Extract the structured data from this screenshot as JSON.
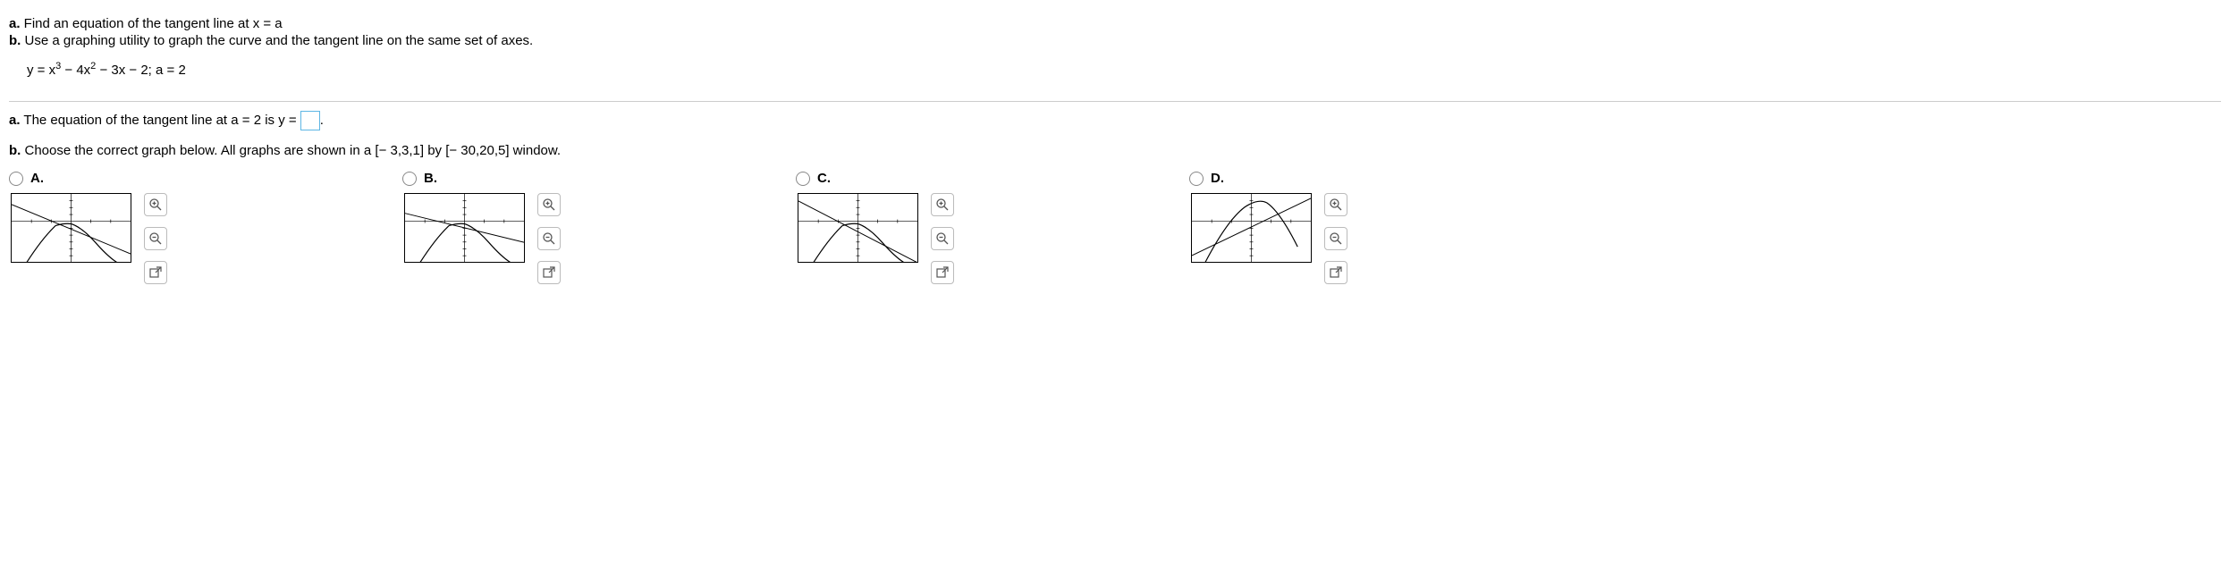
{
  "part_a_label": "a.",
  "part_a_text": " Find an equation of the tangent line at x = a",
  "part_b_label": "b.",
  "part_b_text": " Use a graphing utility to graph the curve and the tangent line on the same set of axes.",
  "equation_text": "y = x³ − 4x² − 3x − 2; a = 2",
  "answer_a_label": "a.",
  "answer_a_text_before": " The equation of the tangent line at a = 2 is y = ",
  "answer_a_text_after": ".",
  "answer_b_label": "b.",
  "answer_b_text": " Choose the correct graph below. All graphs are shown in a [− 3,3,1] by [− 30,20,5] window.",
  "choices": {
    "A": {
      "label": "A."
    },
    "B": {
      "label": "B."
    },
    "C": {
      "label": "C."
    },
    "D": {
      "label": "D."
    }
  },
  "chart_data": {
    "type": "line",
    "note": "Four option graphs each showing the cubic y = x^3 - 4x^2 - 3x - 2 and a straight tangent line, in window x:[-3,3], y:[-30,20]. Options differ by tangent line slope/intercept.",
    "window": {
      "xmin": -3,
      "xmax": 3,
      "xtick": 1,
      "ymin": -30,
      "ymax": 20,
      "ytick": 5
    },
    "options": {
      "A": {
        "curve": "y = x^3 - 4x^2 - 3x - 2",
        "tangent_line": "decreasing line through upper-left quadrant"
      },
      "B": {
        "curve": "y = x^3 - 4x^2 - 3x - 2",
        "tangent_line": "decreasing line, shallower, through (2,-16)"
      },
      "C": {
        "curve": "y = x^3 - 4x^2 - 3x - 2",
        "tangent_line": "decreasing line similar to A, slightly shifted"
      },
      "D": {
        "curve": "y = x^3 - 4x^2 - 3x - 2",
        "tangent_line": "increasing line from lower-left to upper-right"
      }
    }
  }
}
